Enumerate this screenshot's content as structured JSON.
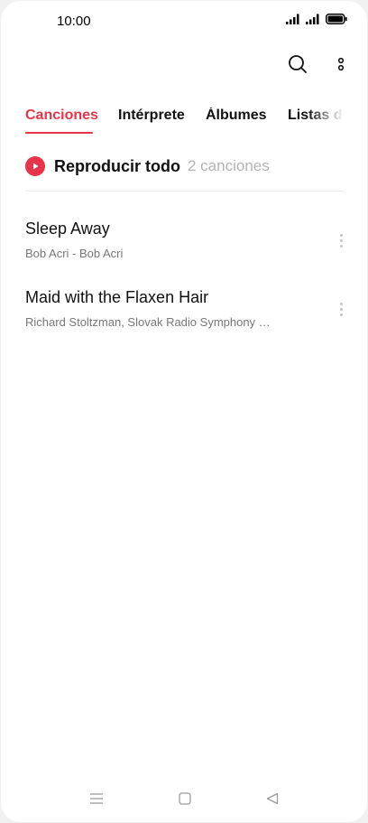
{
  "status_bar": {
    "time": "10:00"
  },
  "toolbar": {
    "search_icon": "search-icon",
    "more_icon": "more-vertical-icon"
  },
  "tabs": [
    {
      "label": "Canciones",
      "active": true
    },
    {
      "label": "Intérprete",
      "active": false
    },
    {
      "label": "Álbumes",
      "active": false
    },
    {
      "label": "Listas de",
      "active": false
    }
  ],
  "play_all": {
    "label": "Reproducir todo",
    "count": "2 canciones"
  },
  "songs": [
    {
      "title": "Sleep Away",
      "subtitle": "Bob Acri - Bob Acri"
    },
    {
      "title": "Maid with the Flaxen Hair",
      "subtitle": "Richard Stoltzman, Slovak Radio Symphony …"
    }
  ],
  "colors": {
    "accent": "#e6354a",
    "text_primary": "#111111",
    "text_secondary": "#777777",
    "text_muted": "#b3b3b3"
  },
  "nav_bar": {
    "menu_icon": "menu-icon",
    "home_icon": "home-square-icon",
    "back_icon": "back-triangle-icon"
  }
}
